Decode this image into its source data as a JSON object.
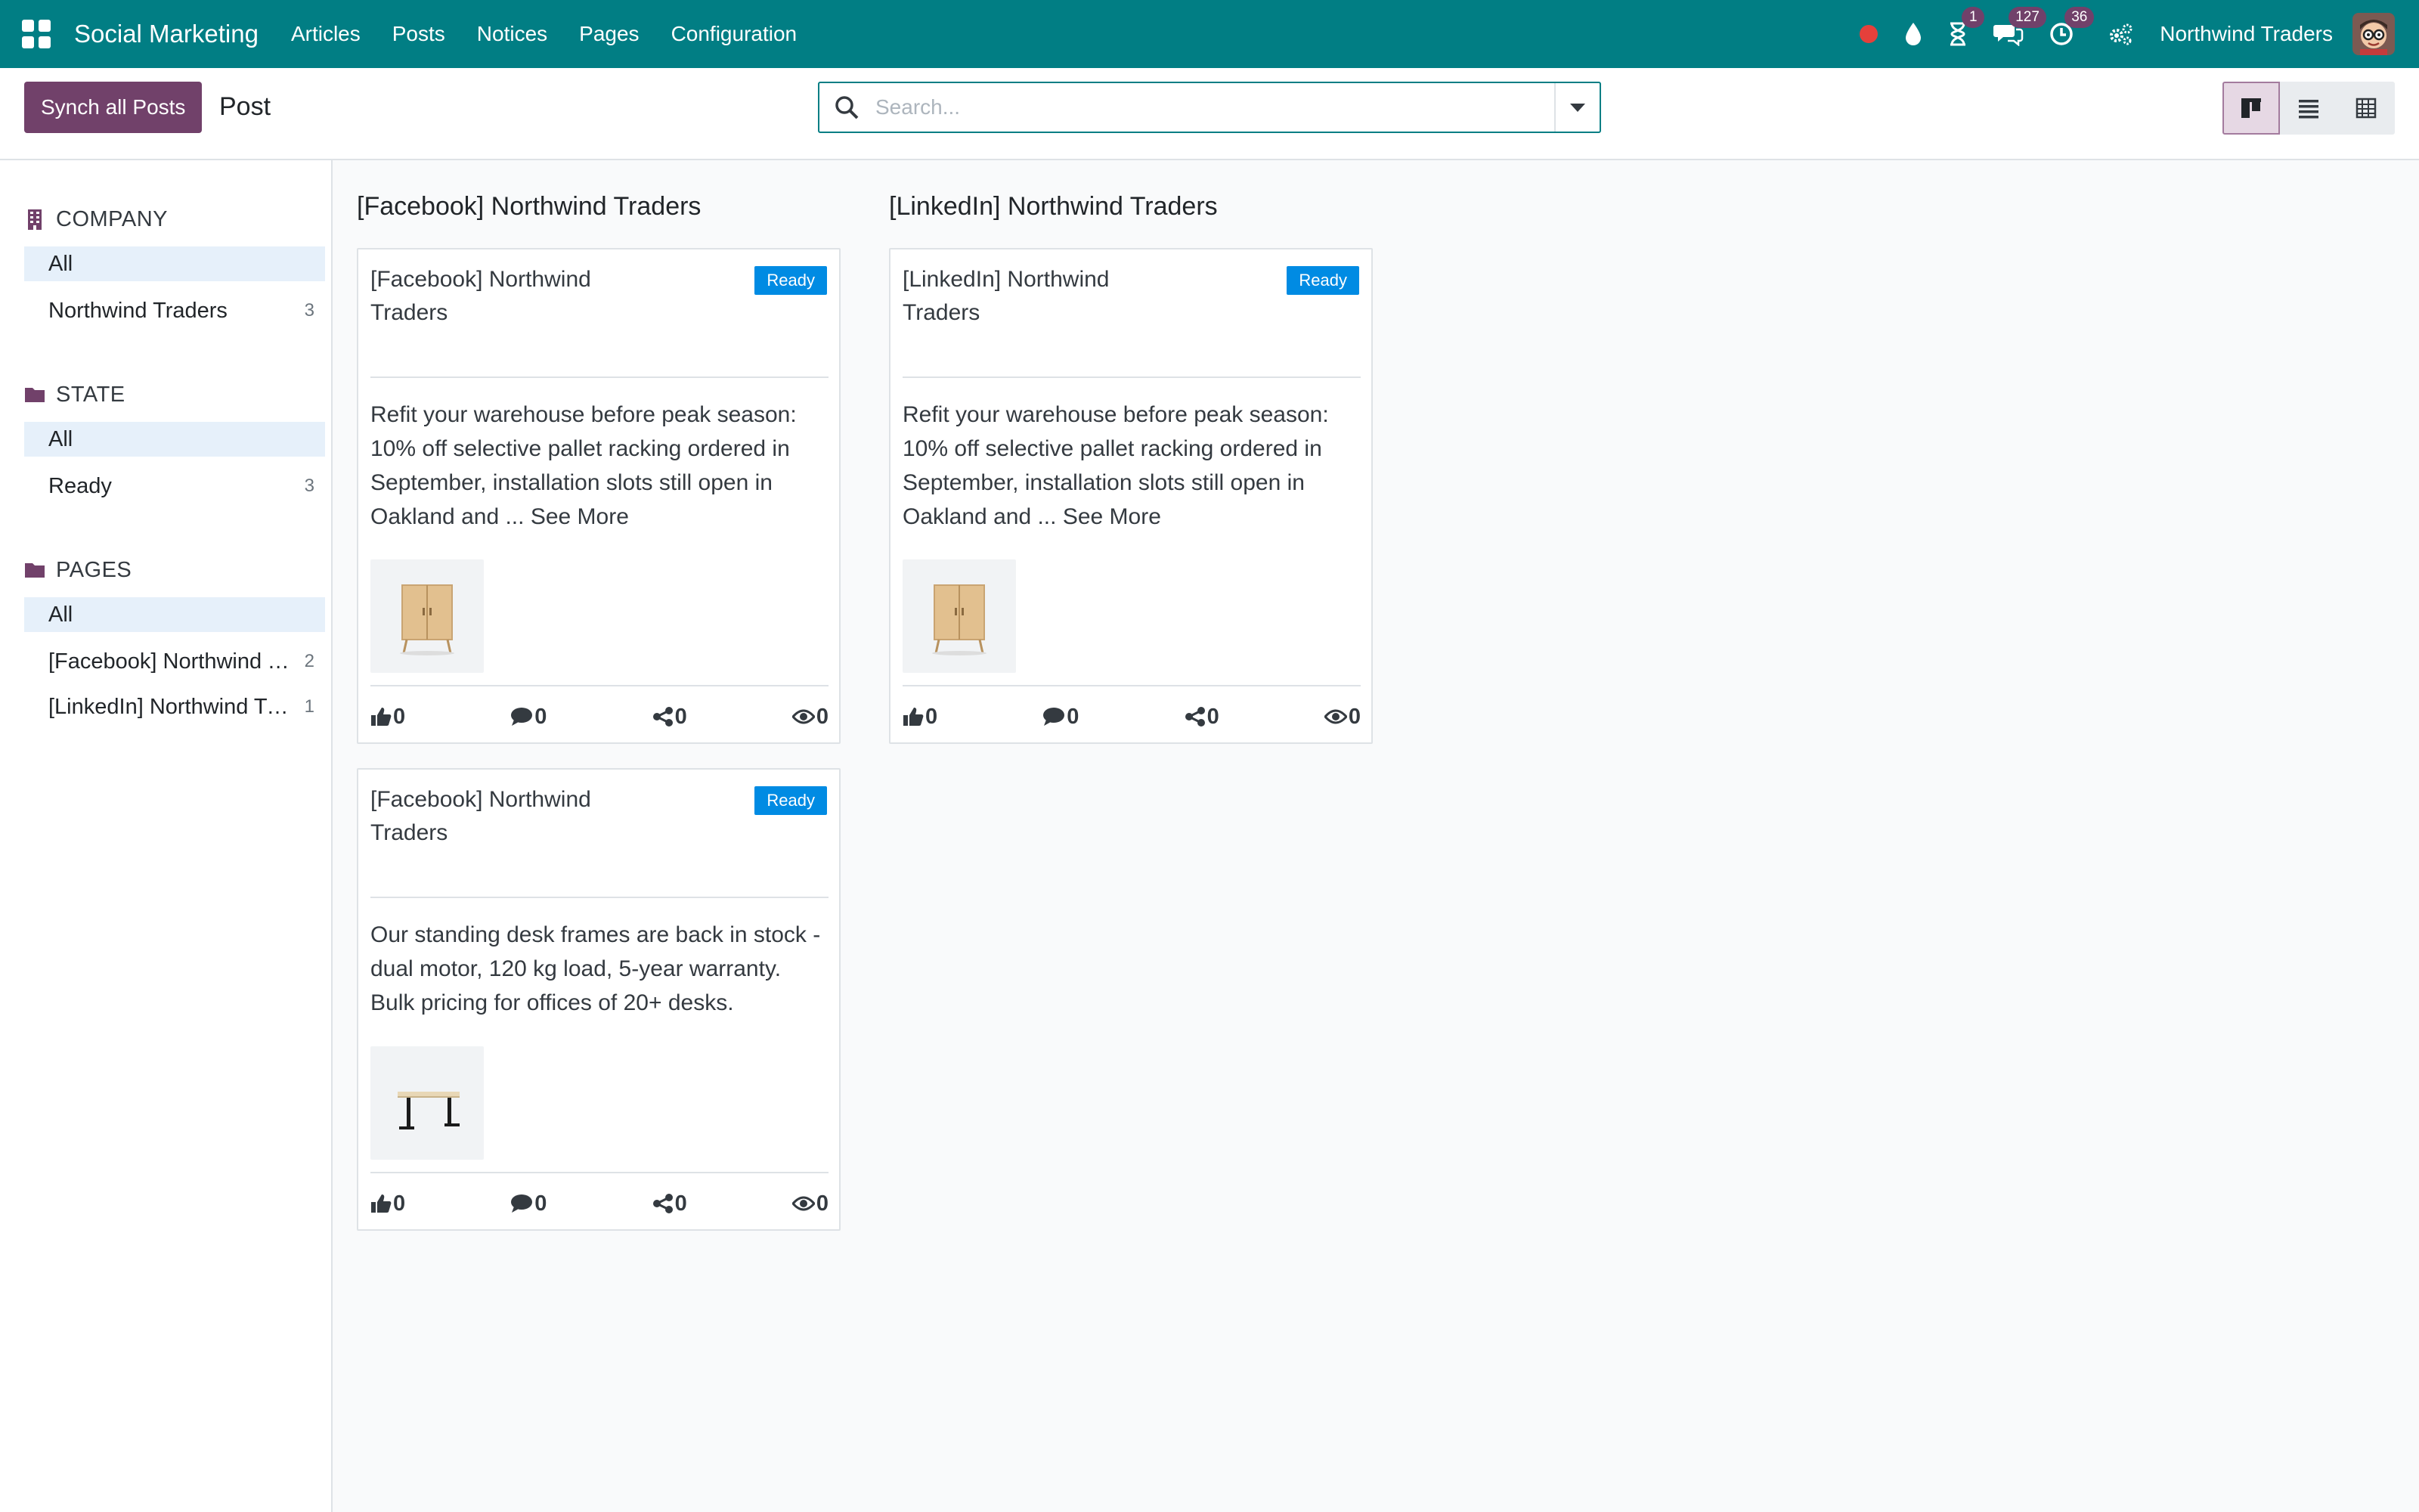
{
  "navbar": {
    "app_name": "Social Marketing",
    "menu": [
      "Articles",
      "Posts",
      "Notices",
      "Pages",
      "Configuration"
    ],
    "badges": {
      "activity": "1",
      "messages": "127",
      "clock": "36"
    },
    "company": "Northwind Traders"
  },
  "control": {
    "sync_button": "Synch all Posts",
    "breadcrumb": "Post",
    "search_placeholder": "Search..."
  },
  "sidebar": {
    "company": {
      "title": "COMPANY",
      "items": [
        {
          "label": "All",
          "count": ""
        },
        {
          "label": "Northwind Traders",
          "count": "3"
        }
      ]
    },
    "state": {
      "title": "STATE",
      "items": [
        {
          "label": "All",
          "count": ""
        },
        {
          "label": "Ready",
          "count": "3"
        }
      ]
    },
    "pages": {
      "title": "PAGES",
      "items": [
        {
          "label": "All",
          "count": ""
        },
        {
          "label": "[Facebook] Northwind Traders",
          "count": "2"
        },
        {
          "label": "[LinkedIn] Northwind Traders",
          "count": "1"
        }
      ]
    }
  },
  "columns": [
    {
      "title": "[Facebook] Northwind Traders",
      "cards": [
        {
          "title": "[Facebook] Northwind Traders",
          "status": "Ready",
          "message": "Refit your warehouse before peak season: 10% off selective pallet racking ordered in September, installation slots still open in Oakland and ...",
          "see_more": "See More",
          "image": "cabinet",
          "likes": "0",
          "comments": "0",
          "shares": "0",
          "views": "0"
        },
        {
          "title": "[Facebook] Northwind Traders",
          "status": "Ready",
          "message": "Our standing desk frames are back in stock - dual motor, 120 kg load, 5-year warranty. Bulk pricing for offices of 20+ desks.",
          "see_more": "",
          "image": "desk",
          "likes": "0",
          "comments": "0",
          "shares": "0",
          "views": "0"
        }
      ]
    },
    {
      "title": "[LinkedIn] Northwind Traders",
      "cards": [
        {
          "title": "[LinkedIn] Northwind Traders",
          "status": "Ready",
          "message": "Refit your warehouse before peak season: 10% off selective pallet racking ordered in September, installation slots still open in Oakland and ...",
          "see_more": "See More",
          "image": "cabinet",
          "likes": "0",
          "comments": "0",
          "shares": "0",
          "views": "0"
        }
      ]
    }
  ],
  "colors": {
    "navbar": "#017e84",
    "primary": "#71416a",
    "ready": "#008be3"
  }
}
